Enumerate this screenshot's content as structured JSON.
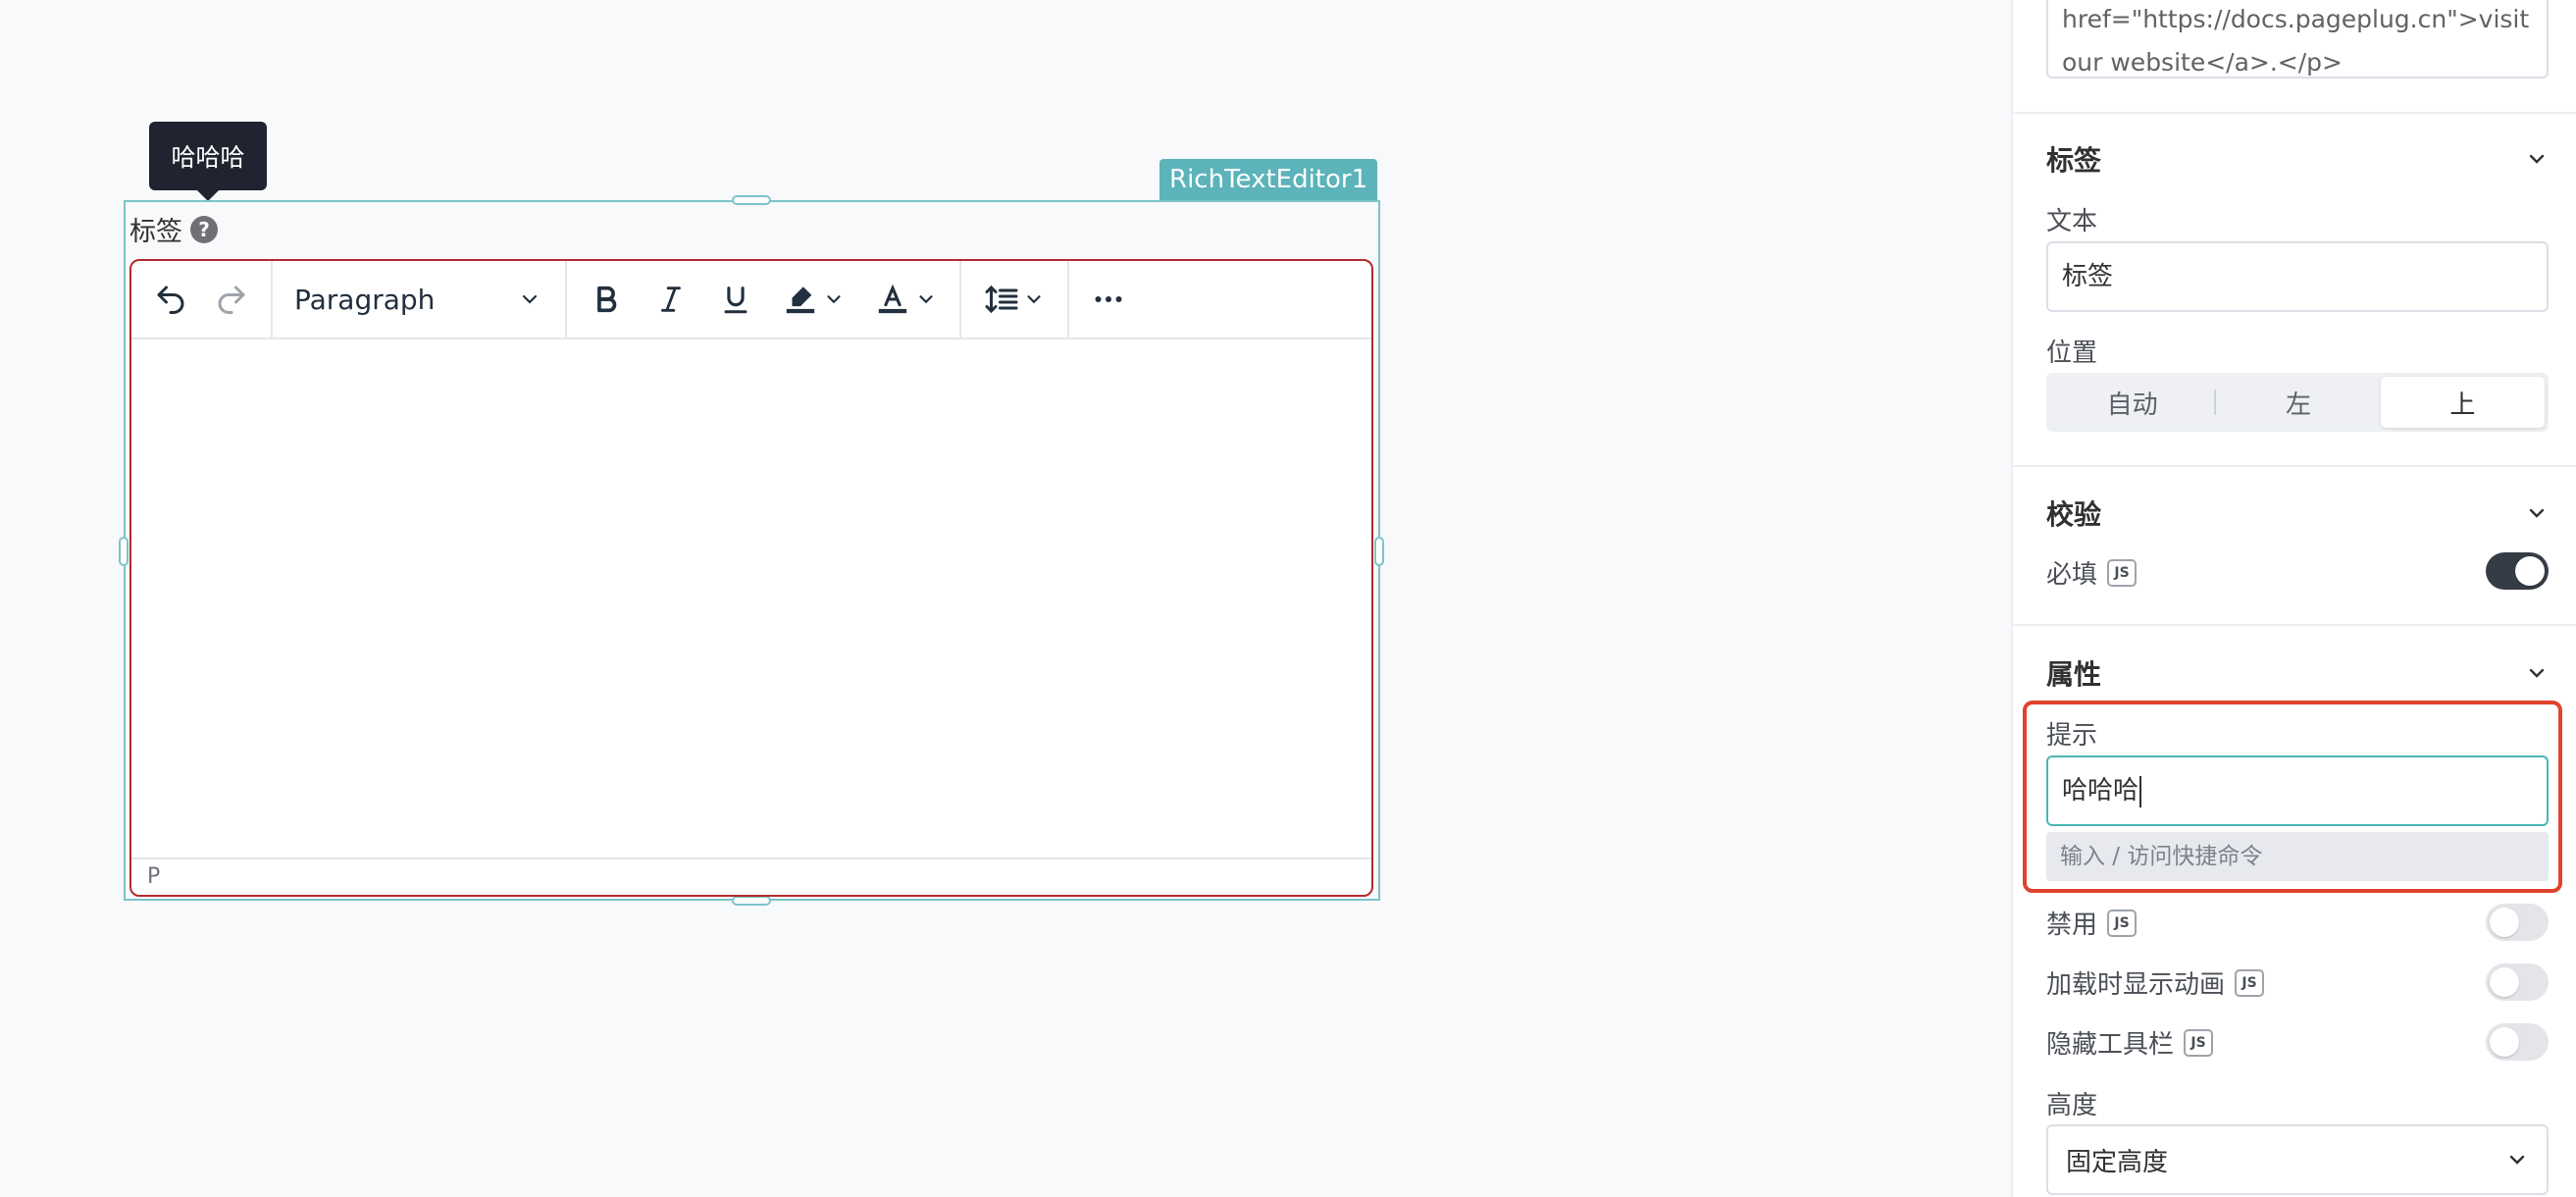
{
  "canvas": {
    "tooltip_text": "哈哈哈",
    "widget_name": "RichTextEditor1",
    "label_text": "标签",
    "toolbar": {
      "block_format": "Paragraph",
      "icons": [
        "undo-icon",
        "redo-icon",
        "bold-icon",
        "italic-icon",
        "underline-icon",
        "highlight-icon",
        "font-color-icon",
        "line-height-icon",
        "more-icon"
      ]
    },
    "statusbar_path": "P"
  },
  "panel": {
    "content_tail_line1": "href=\"https://docs.pageplug.cn\">visit",
    "content_tail_line2": "our website</a>.</p>",
    "sections": {
      "label": {
        "title": "标签",
        "text_label": "文本",
        "text_value": "标签",
        "position_label": "位置",
        "position_options": [
          "自动",
          "左",
          "上"
        ],
        "position_selected": "上"
      },
      "validation": {
        "title": "校验",
        "required_label": "必填",
        "required_on": true
      },
      "properties": {
        "title": "属性",
        "tooltip_label": "提示",
        "tooltip_value": "哈哈哈",
        "command_hint": "输入 / 访问快捷命令",
        "disabled_label": "禁用",
        "disabled_on": false,
        "animate_label": "加载时显示动画",
        "animate_on": false,
        "hide_toolbar_label": "隐藏工具栏",
        "hide_toolbar_on": false,
        "height_label": "高度",
        "height_value": "固定高度"
      }
    },
    "js_badge": "JS"
  },
  "colors": {
    "widget_accent": "#5cb3ba",
    "highlight_border": "#e0432c",
    "editor_error_border": "#b22c2c",
    "toggle_on": "#353c45"
  }
}
